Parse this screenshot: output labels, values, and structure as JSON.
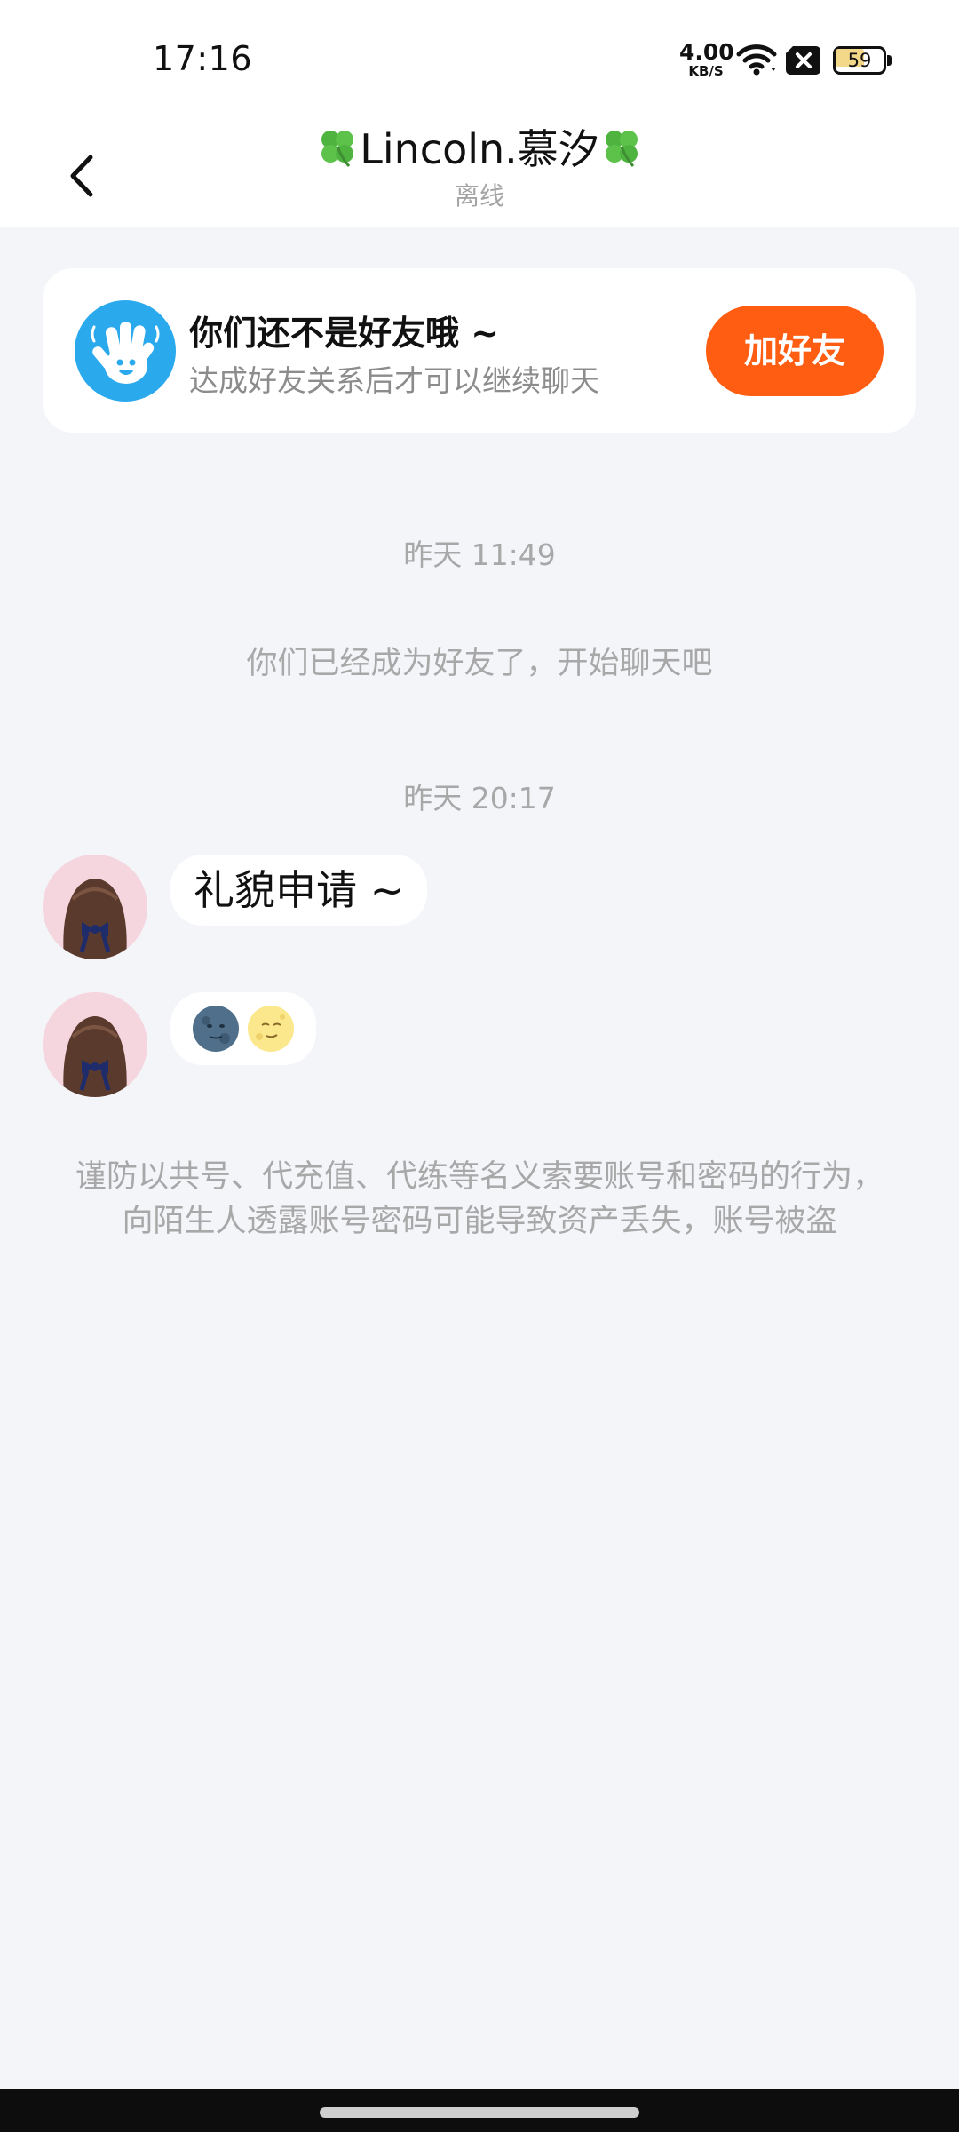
{
  "status_bar": {
    "time": "17:16",
    "net_speed_value": "4.00",
    "net_speed_unit": "KB/S",
    "battery_level": "59",
    "battery_fraction": 0.59,
    "icons": [
      "wifi-icon",
      "sim-x-icon",
      "battery-icon"
    ]
  },
  "header": {
    "title": "Lincoln.慕汐",
    "title_decoration_icon": "four-leaf-clover-icon",
    "status": "离线",
    "back_icon": "chevron-left-icon"
  },
  "friend_banner": {
    "title": "你们还不是好友哦 ~",
    "subtitle": "达成好友关系后才可以继续聊天",
    "button_label": "加好友",
    "button_color": "#ff5d12",
    "icon": "waving-hand-icon"
  },
  "chat": {
    "items": [
      {
        "type": "timestamp",
        "text": "昨天 11:49"
      },
      {
        "type": "system",
        "text": "你们已经成为好友了，开始聊天吧"
      },
      {
        "type": "timestamp",
        "text": "昨天 20:17"
      },
      {
        "type": "message",
        "sender": "contact",
        "text": "礼貌申请 ~"
      },
      {
        "type": "message",
        "sender": "contact",
        "emojis": [
          "new-moon-face-emoji",
          "full-moon-face-emoji"
        ]
      }
    ]
  },
  "warning": "谨防以共号、代充值、代练等名义索要账号和密码的行为，向陌生人透露账号密码可能导致资产丢失，账号被盗",
  "colors": {
    "background": "#f3f5f9",
    "accent": "#ff5d12",
    "muted_text": "#a8a8a8"
  }
}
